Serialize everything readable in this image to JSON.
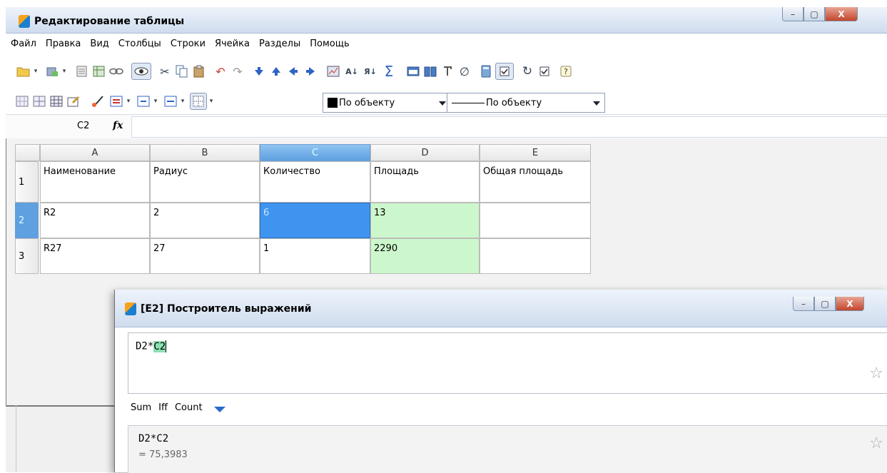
{
  "window": {
    "title": "Редактирование таблицы",
    "buttons": [
      "–",
      "▢",
      "X"
    ]
  },
  "menu": [
    "Файл",
    "Правка",
    "Вид",
    "Столбцы",
    "Строки",
    "Ячейка",
    "Разделы",
    "Помощь"
  ],
  "toolbar2": {
    "fill_dropdown": "По объекту",
    "line_dropdown": "По объекту"
  },
  "formula_bar": {
    "cell_ref": "C2",
    "fx_label": "fx",
    "value": ""
  },
  "grid": {
    "columns": [
      "A",
      "B",
      "C",
      "D",
      "E"
    ],
    "selected_column": "C",
    "rows": [
      {
        "num": "1",
        "cells": [
          "Наименование",
          "Радиус",
          "Количество",
          "Площадь",
          "Общая площадь"
        ]
      },
      {
        "num": "2",
        "cells": [
          "R2",
          "2",
          "6",
          "13",
          ""
        ]
      },
      {
        "num": "3",
        "cells": [
          "R27",
          "27",
          "1",
          "2290",
          ""
        ]
      }
    ],
    "highlight_green": [
      "D2",
      "D3"
    ],
    "active_cell": "C2"
  },
  "dialog": {
    "title": "[E2] Построитель выражений",
    "expression_plain": "D2*",
    "expression_ref": "C2",
    "functions": [
      "Sum",
      "Iff",
      "Count"
    ],
    "result_expression": "D2*C2",
    "result_value": "= 75,3983"
  },
  "colors": {
    "active_cell": "#3f94f0",
    "green_cell": "#ccf7cc",
    "selected_header": "#5ea0e0"
  }
}
